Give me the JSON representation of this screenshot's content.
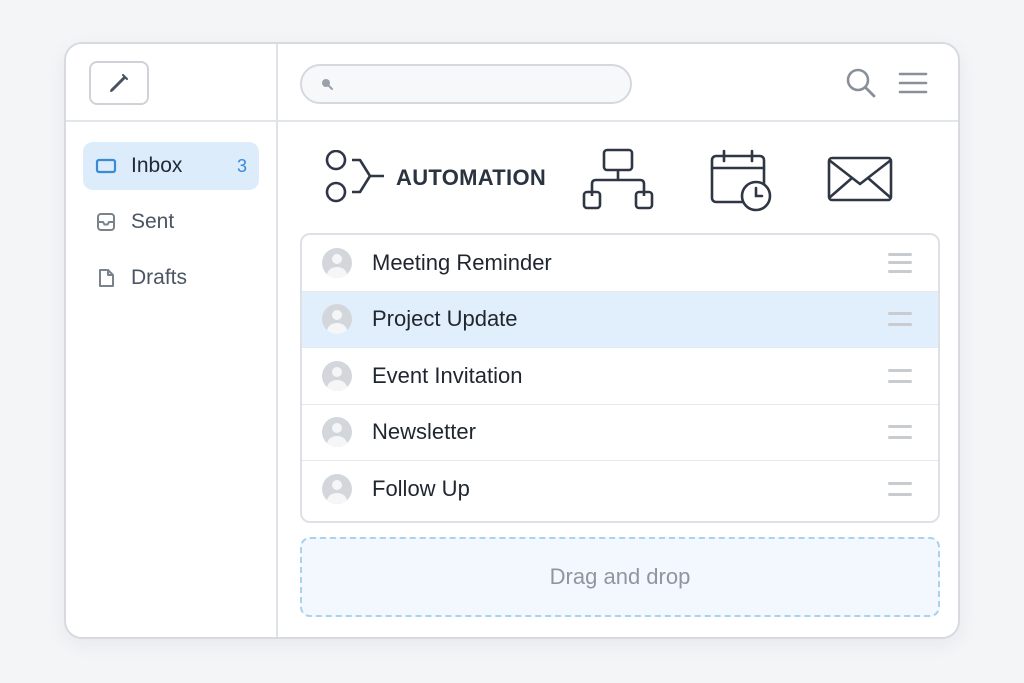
{
  "sidebar": {
    "compose_icon": "pencil-icon",
    "items": [
      {
        "label": "Inbox",
        "count": "3",
        "icon": "inbox-icon",
        "active": true
      },
      {
        "label": "Sent",
        "count": "",
        "icon": "tray-icon",
        "active": false
      },
      {
        "label": "Drafts",
        "count": "",
        "icon": "document-icon",
        "active": false
      }
    ]
  },
  "header": {
    "search_placeholder": "",
    "search_icon": "search-icon",
    "menu_icon": "hamburger-icon"
  },
  "toolbar": {
    "automation_label": "AUTOMATION",
    "icons": [
      "workflow-icon",
      "hierarchy-icon",
      "calendar-clock-icon",
      "envelope-icon"
    ]
  },
  "messages": [
    {
      "subject": "Meeting Reminder",
      "selected": false
    },
    {
      "subject": "Project Update",
      "selected": true
    },
    {
      "subject": "Event Invitation",
      "selected": false
    },
    {
      "subject": "Newsletter",
      "selected": false
    },
    {
      "subject": "Follow Up",
      "selected": false
    }
  ],
  "dropzone": {
    "label": "Drag and drop"
  },
  "colors": {
    "accent": "#3a8ad6",
    "active_bg": "#dcecfb",
    "selected_row_bg": "#e1effc",
    "dropzone_border": "#a9d2ef"
  }
}
